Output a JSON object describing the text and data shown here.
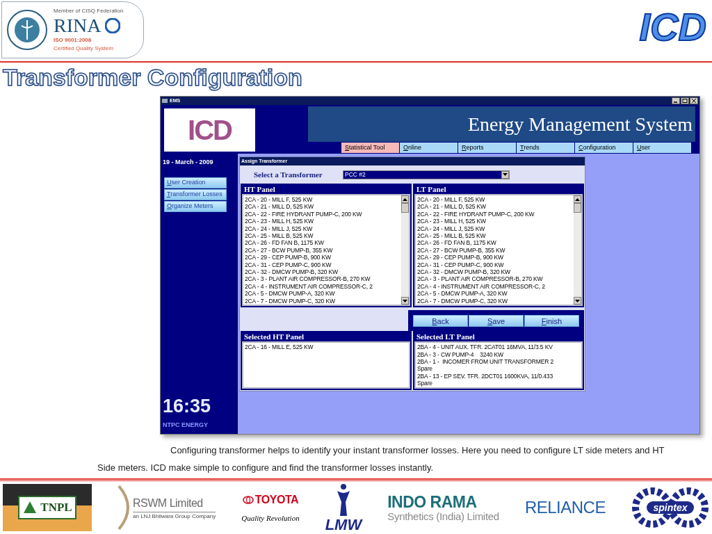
{
  "header": {
    "cert_logo": {
      "line1": "Member of CISQ Federation",
      "brand": "RINA",
      "standard": "ISO 9001:2008",
      "caption": "Certified Quality System"
    },
    "company_logo": "ICD"
  },
  "slide_title": "Transformer Configuration",
  "window": {
    "title": "EMS",
    "logo": "ICD",
    "banner": "Energy Management System",
    "menu": [
      {
        "label": "Statistical Tool",
        "selected": true
      },
      {
        "label": "Online",
        "selected": false
      },
      {
        "label": "Reports",
        "selected": false
      },
      {
        "label": "Trends",
        "selected": false
      },
      {
        "label": "Configuration",
        "selected": false
      },
      {
        "label": "User",
        "selected": false
      }
    ],
    "date": "19 - March - 2009",
    "nav": [
      "User Creation",
      "Transformer Losses",
      "Organize Meters"
    ],
    "clock": "16:35",
    "brand_footer": "NTPC ENERGY",
    "dialog": {
      "title": "Assign Transformer",
      "select_label": "Select a Transformer",
      "select_value": "PCC #2",
      "panels": [
        {
          "title": "HT Panel",
          "items": [
            "2CA - 20 - MILL F, 525 KW",
            "2CA - 21 - MILL D, 525 KW",
            "2CA - 22 - FIRE HYDRANT PUMP-C, 200 KW",
            "2CA - 23 - MILL H, 525 KW",
            "2CA - 24 - MILL J, 525 KW",
            "2CA - 25 - MILL B, 525 KW",
            "2CA - 26 - FD FAN B, 1175 KW",
            "2CA - 27 - BCW PUMP-B, 355 KW",
            "2CA - 29 - CEP PUMP-B, 900 KW",
            "2CA - 31 - CEP PUMP-C, 900 KW",
            "2CA - 32 - DMCW PUMP-B, 320 KW",
            "2CA - 3 - PLANT AIR COMPRESSOR-B, 270 KW",
            "2CA - 4 - INSTRUMENT AIR COMPRESSOR-C, 2",
            "2CA - 5 - DMCW PUMP-A, 320 KW",
            "2CA - 7 - DMCW PUMP-C, 320 KW"
          ]
        },
        {
          "title": "LT Panel",
          "items": [
            "2CA - 20 - MILL F, 525 KW",
            "2CA - 21 - MILL D, 525 KW",
            "2CA - 22 - FIRE HYDRANT PUMP-C, 200 KW",
            "2CA - 23 - MILL H, 525 KW",
            "2CA - 24 - MILL J, 525 KW",
            "2CA - 25 - MILL B, 525 KW",
            "2CA - 26 - FD FAN B, 1175 KW",
            "2CA - 27 - BCW PUMP-B, 355 KW",
            "2CA - 29 - CEP PUMP-B, 900 KW",
            "2CA - 31 - CEP PUMP-C, 900 KW",
            "2CA - 32 - DMCW PUMP-B, 320 KW",
            "2CA - 3 - PLANT AIR COMPRESSOR-B, 270 KW",
            "2CA - 4 - INSTRUMENT AIR COMPRESSOR-C, 2",
            "2CA - 5 - DMCW PUMP-A, 320 KW",
            "2CA - 7 - DMCW PUMP-C, 320 KW"
          ]
        }
      ],
      "buttons": [
        "Back",
        "Save",
        "Finish"
      ],
      "selected_panels": [
        {
          "title": "Selected HT Panel",
          "items": [
            "2CA - 16 - MILL E, 525 KW"
          ]
        },
        {
          "title": "Selected LT Panel",
          "items": [
            "2BA - 4 - UNIT AUX. TFR. 2CAT01 16MVA, 11/3.5 KV",
            "2BA - 3 - CW PUMP-4    3240 KW",
            "2BA - 1 -  INCOMER FROM UNIT TRANSFORMER 2",
            "Spare",
            "2BA - 13 - EP SEV. TFR. 2DCT01 1600KVA, 11/0.433",
            "Spare"
          ]
        }
      ]
    }
  },
  "caption": "Configuring transformer helps to identify your instant transformer losses. Here you need to configure LT side meters and HT Side meters. ICD make simple to configure and find the transformer losses instantly.",
  "partner_logos": [
    {
      "kind": "tnpl",
      "name": "TNPL"
    },
    {
      "kind": "rswm",
      "name": "RSWM Limited",
      "tagline": "an LNJ Bhilwara Group Company"
    },
    {
      "kind": "toyota",
      "name": "TOYOTA",
      "tagline": "Quality Revolution"
    },
    {
      "kind": "lmw",
      "name": "LMW"
    },
    {
      "kind": "indorama",
      "name": "INDO RAMA",
      "tagline": "Synthetics (India) Limited"
    },
    {
      "kind": "reliance",
      "name": "RELIANCE"
    },
    {
      "kind": "spintex",
      "name": "spintex"
    }
  ]
}
